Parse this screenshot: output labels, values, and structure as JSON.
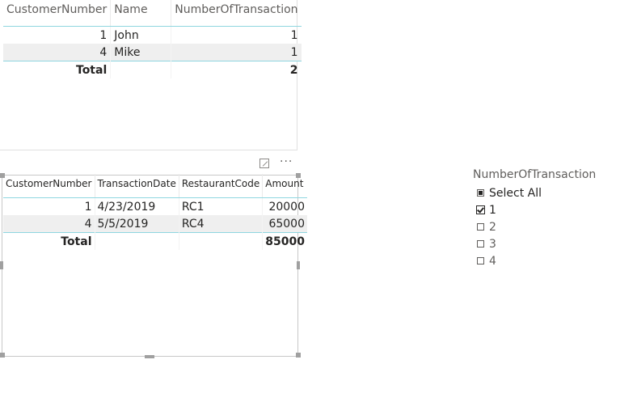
{
  "table1": {
    "headers": [
      "CustomerNumber",
      "Name",
      "NumberOfTransaction"
    ],
    "rows": [
      {
        "customer_number": "1",
        "name": "John",
        "transactions": "1"
      },
      {
        "customer_number": "4",
        "name": "Mike",
        "transactions": "1"
      }
    ],
    "total": {
      "label": "Total",
      "transactions": "2"
    }
  },
  "table2": {
    "headers": [
      "CustomerNumber",
      "TransactionDate",
      "RestaurantCode",
      "Amount"
    ],
    "rows": [
      {
        "customer_number": "1",
        "date": "4/23/2019",
        "restaurant": "RC1",
        "amount": "20000"
      },
      {
        "customer_number": "4",
        "date": "5/5/2019",
        "restaurant": "RC4",
        "amount": "65000"
      }
    ],
    "total": {
      "label": "Total",
      "amount": "85000"
    }
  },
  "visual_header": {
    "more_label": "···",
    "focus_icon": "focus-mode-icon",
    "more_icon": "more-options-icon"
  },
  "slicer": {
    "title": "NumberOfTransaction",
    "items": [
      {
        "label": "Select All",
        "state": "partial"
      },
      {
        "label": "1",
        "state": "checked"
      },
      {
        "label": "2",
        "state": "unchecked"
      },
      {
        "label": "3",
        "state": "unchecked"
      },
      {
        "label": "4",
        "state": "unchecked"
      }
    ]
  },
  "colors": {
    "accent_line": "#8fd6e0",
    "alt_row": "#efefef",
    "text": "#252423",
    "muted_text": "#605e5c",
    "selection_border": "#c8c8c8"
  }
}
